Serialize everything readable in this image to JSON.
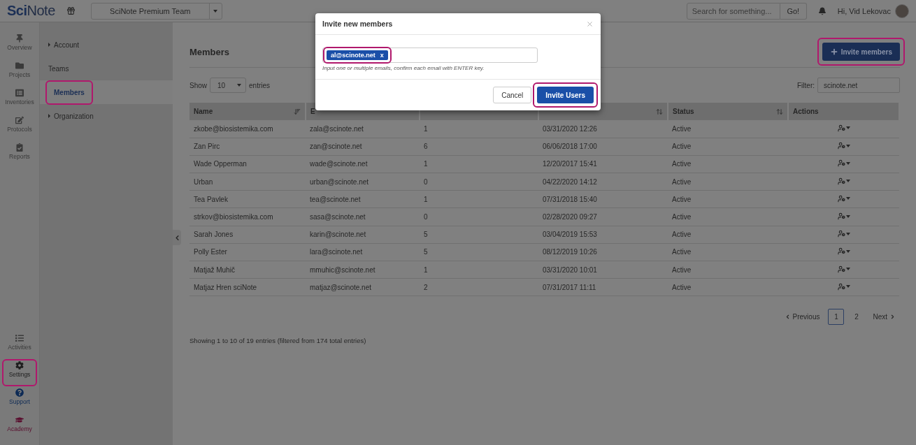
{
  "topbar": {
    "logo_bold": "Sci",
    "logo_rest": "Note",
    "team": "SciNote Premium Team",
    "search": {
      "placeholder": "Search for something..."
    },
    "search_button": "Go!",
    "greeting": "Hi, Vid Lekovac"
  },
  "rail": [
    {
      "label": "Overview",
      "highlighted": false,
      "color": "#3a3a3a"
    },
    {
      "label": "Projects",
      "highlighted": false,
      "color": "#3a3a3a"
    },
    {
      "label": "Inventories",
      "highlighted": false,
      "color": "#3a3a3a"
    },
    {
      "label": "Protocols",
      "highlighted": false,
      "color": "#3a3a3a"
    },
    {
      "label": "Reports",
      "highlighted": false,
      "color": "#3a3a3a"
    }
  ],
  "rail_bottom": [
    {
      "label": "Activities",
      "highlighted": false,
      "color": "#3a3a3a"
    },
    {
      "label": "Settings",
      "highlighted": true,
      "color": "#1e1e1e"
    },
    {
      "label": "Support",
      "highlighted": false,
      "color": "#0d2a55"
    },
    {
      "label": "Academy",
      "highlighted": false,
      "color": "#5a0f2f"
    }
  ],
  "settings_nav": [
    {
      "label": "Account",
      "kind": "group",
      "selected": false,
      "highlighted": false
    },
    {
      "label": "Teams",
      "kind": "link",
      "selected": false,
      "highlighted": false
    },
    {
      "label": "Members",
      "kind": "link",
      "selected": true,
      "highlighted": true
    },
    {
      "label": "Organization",
      "kind": "group",
      "selected": false,
      "highlighted": false
    }
  ],
  "main": {
    "title": "Members",
    "invite_button": {
      "label": "Invite members",
      "highlighted": true
    },
    "show_label": "Show",
    "page_size": "10",
    "entries_label": "entries",
    "filter_label": "Filter:",
    "filter_value": "scinote.net",
    "table": {
      "columns": [
        {
          "label": "Name",
          "sortable": true,
          "sorted": true
        },
        {
          "label": "E",
          "sortable": false,
          "sorted": false
        },
        {
          "sortable": false,
          "sorted": false
        },
        {
          "sortable": true,
          "sorted": false
        },
        {
          "label": "Status",
          "sortable": true,
          "sorted": false
        },
        {
          "label": "Actions",
          "sortable": false,
          "sorted": false
        }
      ],
      "rows": [
        [
          "zkobe@biosistemika.com",
          "zala@scinote.net",
          "1",
          "03/31/2020 12:26",
          "Active"
        ],
        [
          "Zan Pirc",
          "zan@scinote.net",
          "6",
          "06/06/2018 17:00",
          "Active"
        ],
        [
          "Wade Opperman",
          "wade@scinote.net",
          "1",
          "12/20/2017 15:41",
          "Active"
        ],
        [
          "Urban",
          "urban@scinote.net",
          "0",
          "04/22/2020 14:12",
          "Active"
        ],
        [
          "Tea Pavlek",
          "tea@scinote.net",
          "1",
          "07/31/2018 15:40",
          "Active"
        ],
        [
          "strkov@biosistemika.com",
          "sasa@scinote.net",
          "0",
          "02/28/2020 09:27",
          "Active"
        ],
        [
          "Sarah Jones",
          "karin@scinote.net",
          "5",
          "03/04/2019 15:53",
          "Active"
        ],
        [
          "Polly Ester",
          "lara@scinote.net",
          "5",
          "08/12/2019 10:26",
          "Active"
        ],
        [
          "Matjaž Muhič",
          "mmuhic@scinote.net",
          "1",
          "03/31/2020 10:01",
          "Active"
        ],
        [
          "Matjaz Hren sciNote",
          "matjaz@scinote.net",
          "2",
          "07/31/2017 11:11",
          "Active"
        ]
      ]
    },
    "pagination": {
      "previous": "Previous",
      "pages": [
        {
          "label": "1",
          "selected": true
        },
        {
          "label": "2",
          "selected": false
        }
      ],
      "next": "Next"
    },
    "info": "Showing 1 to 10 of 19 entries (filtered from 174 total entries)"
  },
  "modal": {
    "title": "Invite new members",
    "tags": [
      {
        "label": "al@scinote.net",
        "highlighted": true
      }
    ],
    "remove": "x",
    "hint": "Input one or multiple emails, confirm each email with ENTER key.",
    "cancel": "Cancel",
    "submit": {
      "label": "Invite Users",
      "highlighted": true
    }
  }
}
